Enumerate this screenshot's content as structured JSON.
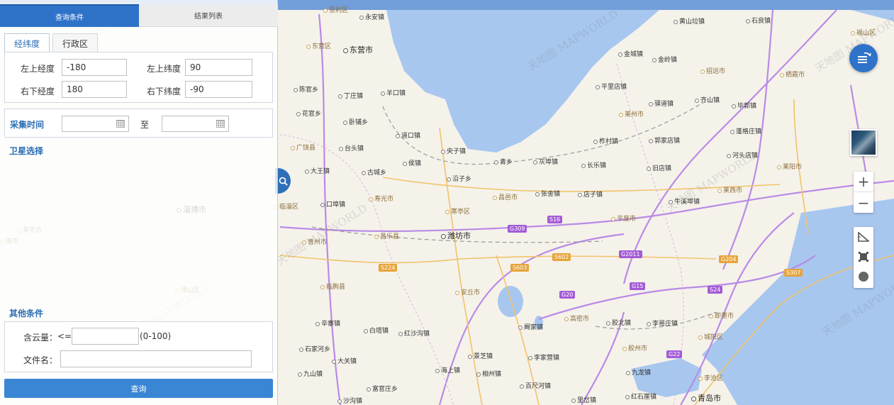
{
  "tabs": {
    "query_conditions": "查询条件",
    "result_list": "结果列表"
  },
  "subtabs": {
    "lat_lon": "经纬度",
    "admin_region": "行政区"
  },
  "coords": {
    "top_left_lon_label": "左上经度",
    "top_left_lon_value": "-180",
    "top_left_lat_label": "左上纬度",
    "top_left_lat_value": "90",
    "bottom_right_lon_label": "右下经度",
    "bottom_right_lon_value": "180",
    "bottom_right_lat_label": "右下纬度",
    "bottom_right_lat_value": "-90"
  },
  "collect_time": {
    "label": "采集时间",
    "to": "至"
  },
  "satellite": {
    "label": "卫星选择"
  },
  "other": {
    "label": "其他条件",
    "cloud_label": "含云量：",
    "cloud_op": "<=",
    "cloud_range": "(0-100)",
    "filename_label": "文件名："
  },
  "query_button": "查询",
  "map": {
    "places": [
      {
        "name": "垦利区",
        "type": "district"
      },
      {
        "name": "永安镇",
        "type": "town"
      },
      {
        "name": "东营区",
        "type": "district"
      },
      {
        "name": "东营市",
        "type": "city"
      },
      {
        "name": "陈官乡",
        "type": "town"
      },
      {
        "name": "丁庄镇",
        "type": "town"
      },
      {
        "name": "羊口镇",
        "type": "town"
      },
      {
        "name": "花官乡",
        "type": "town"
      },
      {
        "name": "卧铺乡",
        "type": "town"
      },
      {
        "name": "道口镇",
        "type": "town"
      },
      {
        "name": "广饶县",
        "type": "district"
      },
      {
        "name": "台头镇",
        "type": "town"
      },
      {
        "name": "央子镇",
        "type": "town"
      },
      {
        "name": "大王镇",
        "type": "town"
      },
      {
        "name": "古城乡",
        "type": "town"
      },
      {
        "name": "侯镇",
        "type": "town"
      },
      {
        "name": "青乡",
        "type": "town"
      },
      {
        "name": "灰埠镇",
        "type": "town"
      },
      {
        "name": "长乐镇",
        "type": "town"
      },
      {
        "name": "旧店镇",
        "type": "town"
      },
      {
        "name": "河头店镇",
        "type": "town"
      },
      {
        "name": "莱阳市",
        "type": "district"
      },
      {
        "name": "沿子乡",
        "type": "town"
      },
      {
        "name": "寿光市",
        "type": "district"
      },
      {
        "name": "昌邑市",
        "type": "district"
      },
      {
        "name": "张舍镇",
        "type": "town"
      },
      {
        "name": "店子镇",
        "type": "town"
      },
      {
        "name": "莱西市",
        "type": "district"
      },
      {
        "name": "口埠镇",
        "type": "town"
      },
      {
        "name": "寒亭区",
        "type": "district"
      },
      {
        "name": "牛溪埠镇",
        "type": "town"
      },
      {
        "name": "临淄区",
        "type": "district"
      },
      {
        "name": "平度市",
        "type": "district"
      },
      {
        "name": "昌乐县",
        "type": "district"
      },
      {
        "name": "潍坊市",
        "type": "city"
      },
      {
        "name": "青州市",
        "type": "district"
      },
      {
        "name": "临朐县",
        "type": "district"
      },
      {
        "name": "安丘市",
        "type": "district"
      },
      {
        "name": "高密市",
        "type": "district"
      },
      {
        "name": "即墨市",
        "type": "district"
      },
      {
        "name": "辛寨镇",
        "type": "town"
      },
      {
        "name": "白塔镇",
        "type": "town"
      },
      {
        "name": "红沙沟镇",
        "type": "town"
      },
      {
        "name": "阚家镇",
        "type": "town"
      },
      {
        "name": "胶北镇",
        "type": "town"
      },
      {
        "name": "李哥庄镇",
        "type": "town"
      },
      {
        "name": "城阳区",
        "type": "district"
      },
      {
        "name": "石家河乡",
        "type": "town"
      },
      {
        "name": "景芝镇",
        "type": "town"
      },
      {
        "name": "李家营镇",
        "type": "town"
      },
      {
        "name": "胶州市",
        "type": "district"
      },
      {
        "name": "大关镇",
        "type": "town"
      },
      {
        "name": "九山镇",
        "type": "town"
      },
      {
        "name": "海上镇",
        "type": "town"
      },
      {
        "name": "相州镇",
        "type": "town"
      },
      {
        "name": "九龙镇",
        "type": "town"
      },
      {
        "name": "李沧区",
        "type": "district"
      },
      {
        "name": "富官庄乡",
        "type": "town"
      },
      {
        "name": "百尺河镇",
        "type": "town"
      },
      {
        "name": "青岛市",
        "type": "city"
      },
      {
        "name": "沙沟镇",
        "type": "town"
      },
      {
        "name": "里岔镇",
        "type": "town"
      },
      {
        "name": "红石崖镇",
        "type": "town"
      },
      {
        "name": "黄山垃镇",
        "type": "town"
      },
      {
        "name": "石良镇",
        "type": "town"
      },
      {
        "name": "福山区",
        "type": "district"
      },
      {
        "name": "金城镇",
        "type": "town"
      },
      {
        "name": "金岭镇",
        "type": "town"
      },
      {
        "name": "招远市",
        "type": "district"
      },
      {
        "name": "栖霞市",
        "type": "district"
      },
      {
        "name": "平里店镇",
        "type": "town"
      },
      {
        "name": "莱州市",
        "type": "district"
      },
      {
        "name": "驿道镇",
        "type": "town"
      },
      {
        "name": "齐山镇",
        "type": "town"
      },
      {
        "name": "毕郭镇",
        "type": "town"
      },
      {
        "name": "柞村镇",
        "type": "town"
      },
      {
        "name": "郭家店镇",
        "type": "town"
      },
      {
        "name": "蓬格庄镇",
        "type": "town"
      },
      {
        "name": "淄博市",
        "type": "city"
      },
      {
        "name": "博山区",
        "type": "district"
      },
      {
        "name": "南市",
        "type": "district"
      },
      {
        "name": "莱芜市",
        "type": "district"
      }
    ],
    "shields": [
      {
        "text": "G309",
        "kind": "g"
      },
      {
        "text": "S16",
        "kind": "g"
      },
      {
        "text": "G2011",
        "kind": "g"
      },
      {
        "text": "G15",
        "kind": "g"
      },
      {
        "text": "G20",
        "kind": "g"
      },
      {
        "text": "G22",
        "kind": "g"
      },
      {
        "text": "S24",
        "kind": "g"
      },
      {
        "text": "G204",
        "kind": "s"
      },
      {
        "text": "S224",
        "kind": "s"
      },
      {
        "text": "S603",
        "kind": "s"
      },
      {
        "text": "S602",
        "kind": "s"
      },
      {
        "text": "S307",
        "kind": "s"
      }
    ],
    "watermark": "天地图 MAPWORLD"
  }
}
